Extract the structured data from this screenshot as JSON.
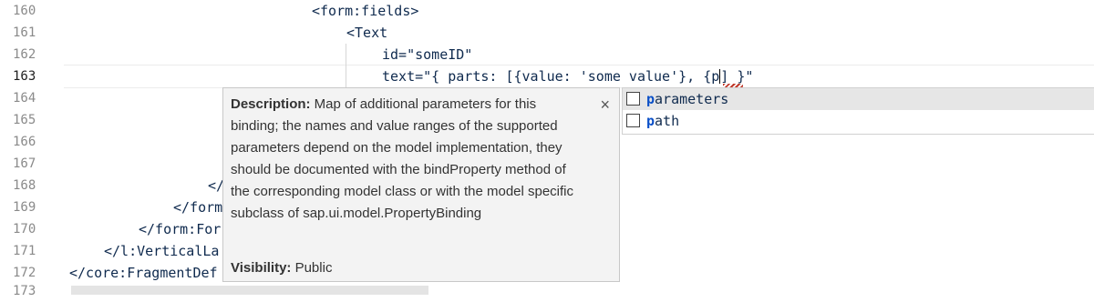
{
  "editor": {
    "lines": [
      {
        "num": "160",
        "text": "<form:fields>"
      },
      {
        "num": "161",
        "text": "<Text"
      },
      {
        "num": "162",
        "text": "id=\"someID\""
      },
      {
        "num": "163",
        "text": "text=\"{ parts: [{value: 'some value'}, {p|] }\""
      },
      {
        "num": "164",
        "text": ""
      },
      {
        "num": "165",
        "text": ""
      },
      {
        "num": "166",
        "text": ""
      },
      {
        "num": "167",
        "text": ""
      },
      {
        "num": "168",
        "text": "</"
      },
      {
        "num": "169",
        "text": "</form"
      },
      {
        "num": "170",
        "text": "</form:For"
      },
      {
        "num": "171",
        "text": "</l:VerticalLa"
      },
      {
        "num": "172",
        "text": "</core:FragmentDef"
      },
      {
        "num": "173",
        "text": ""
      }
    ],
    "line163_pre": "text=\"{ parts: [{value: 'some value'}, {p",
    "line163_post": "] }\""
  },
  "tooltip": {
    "desc_label": "Description:",
    "desc_text": " Map of additional parameters for this binding; the names and value ranges of the supported parameters depend on the model implementation, they should be documented with the bindProperty method of the corresponding model class or with the model specific subclass of sap.ui.model.PropertyBinding",
    "visibility_label": "Visibility:",
    "visibility_value": " Public",
    "close_glyph": "×"
  },
  "suggestions": [
    {
      "match": "p",
      "rest": "arameters",
      "selected": true
    },
    {
      "match": "p",
      "rest": "ath",
      "selected": false
    }
  ]
}
